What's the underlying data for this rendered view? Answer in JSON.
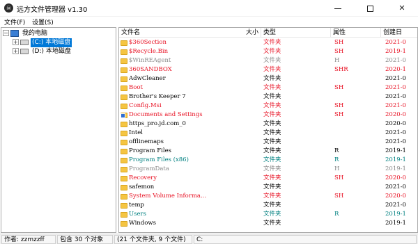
{
  "window": {
    "title": "远方文件管理器 v1.30",
    "icon": "skull-icon",
    "controls": [
      "minimize",
      "maximize",
      "close"
    ]
  },
  "menu": {
    "items": [
      {
        "label": "文件(F)"
      },
      {
        "label": "设置(S)"
      }
    ]
  },
  "tree": {
    "root": {
      "label": "我的电脑",
      "icon": "computer-icon",
      "expander": "⊟"
    },
    "drives": [
      {
        "label": "(C:) 本地磁盘",
        "icon": "drive-icon",
        "expander": "⊞",
        "selected": true
      },
      {
        "label": "(D:) 本地磁盘",
        "icon": "drive-icon",
        "expander": "⊞",
        "selected": false
      }
    ]
  },
  "list": {
    "columns": {
      "name": "文件名",
      "size": "大小",
      "type": "类型",
      "attr": "属性",
      "date": "创建日"
    },
    "rows": [
      {
        "name": "$360Section",
        "type": "文件夹",
        "attr": "SH",
        "date": "2021-0",
        "color": "#e81123"
      },
      {
        "name": "$Recycle.Bin",
        "type": "文件夹",
        "attr": "SH",
        "date": "2019-1",
        "color": "#e81123"
      },
      {
        "name": "$WinREAgent",
        "type": "文件夹",
        "attr": "H",
        "date": "2021-0",
        "color": "#8a8a8a"
      },
      {
        "name": "360SANDBOX",
        "type": "文件夹",
        "attr": "SHR",
        "date": "2020-1",
        "color": "#e81123"
      },
      {
        "name": "AdwCleaner",
        "type": "文件夹",
        "attr": "",
        "date": "2021-0",
        "color": "#000000"
      },
      {
        "name": "Boot",
        "type": "文件夹",
        "attr": "SH",
        "date": "2021-0",
        "color": "#e81123"
      },
      {
        "name": "Brother's Keeper 7",
        "type": "文件夹",
        "attr": "",
        "date": "2021-0",
        "color": "#000000"
      },
      {
        "name": "Config.Msi",
        "type": "文件夹",
        "attr": "SH",
        "date": "2021-0",
        "color": "#e81123"
      },
      {
        "name": "Documents and Settings",
        "type": "文件夹",
        "attr": "SH",
        "date": "2020-0",
        "color": "#e81123",
        "link": true
      },
      {
        "name": "https_pro.jd.com_0",
        "type": "文件夹",
        "attr": "",
        "date": "2020-0",
        "color": "#000000"
      },
      {
        "name": "Intel",
        "type": "文件夹",
        "attr": "",
        "date": "2021-0",
        "color": "#000000"
      },
      {
        "name": "offlinemaps",
        "type": "文件夹",
        "attr": "",
        "date": "2021-0",
        "color": "#000000"
      },
      {
        "name": "Program Files",
        "type": "文件夹",
        "attr": "R",
        "date": "2019-1",
        "color": "#000000"
      },
      {
        "name": "Program Files (x86)",
        "type": "文件夹",
        "attr": "R",
        "date": "2019-1",
        "color": "#008080"
      },
      {
        "name": "ProgramData",
        "type": "文件夹",
        "attr": "H",
        "date": "2019-1",
        "color": "#8a8a8a"
      },
      {
        "name": "Recovery",
        "type": "文件夹",
        "attr": "SH",
        "date": "2020-0",
        "color": "#e81123"
      },
      {
        "name": "safemon",
        "type": "文件夹",
        "attr": "",
        "date": "2021-0",
        "color": "#000000"
      },
      {
        "name": "System Volume Informa...",
        "type": "文件夹",
        "attr": "SH",
        "date": "2020-0",
        "color": "#e81123"
      },
      {
        "name": "temp",
        "type": "文件夹",
        "attr": "",
        "date": "2021-0",
        "color": "#000000"
      },
      {
        "name": "Users",
        "type": "文件夹",
        "attr": "R",
        "date": "2019-1",
        "color": "#008080"
      },
      {
        "name": "Windows",
        "type": "文件夹",
        "attr": "",
        "date": "2019-1",
        "color": "#000000"
      }
    ]
  },
  "status": {
    "author": "作者: zzmzzff",
    "count": "包含 30 个对象",
    "detail": "(21 个文件夹, 9 个文件)",
    "path": "C:"
  }
}
